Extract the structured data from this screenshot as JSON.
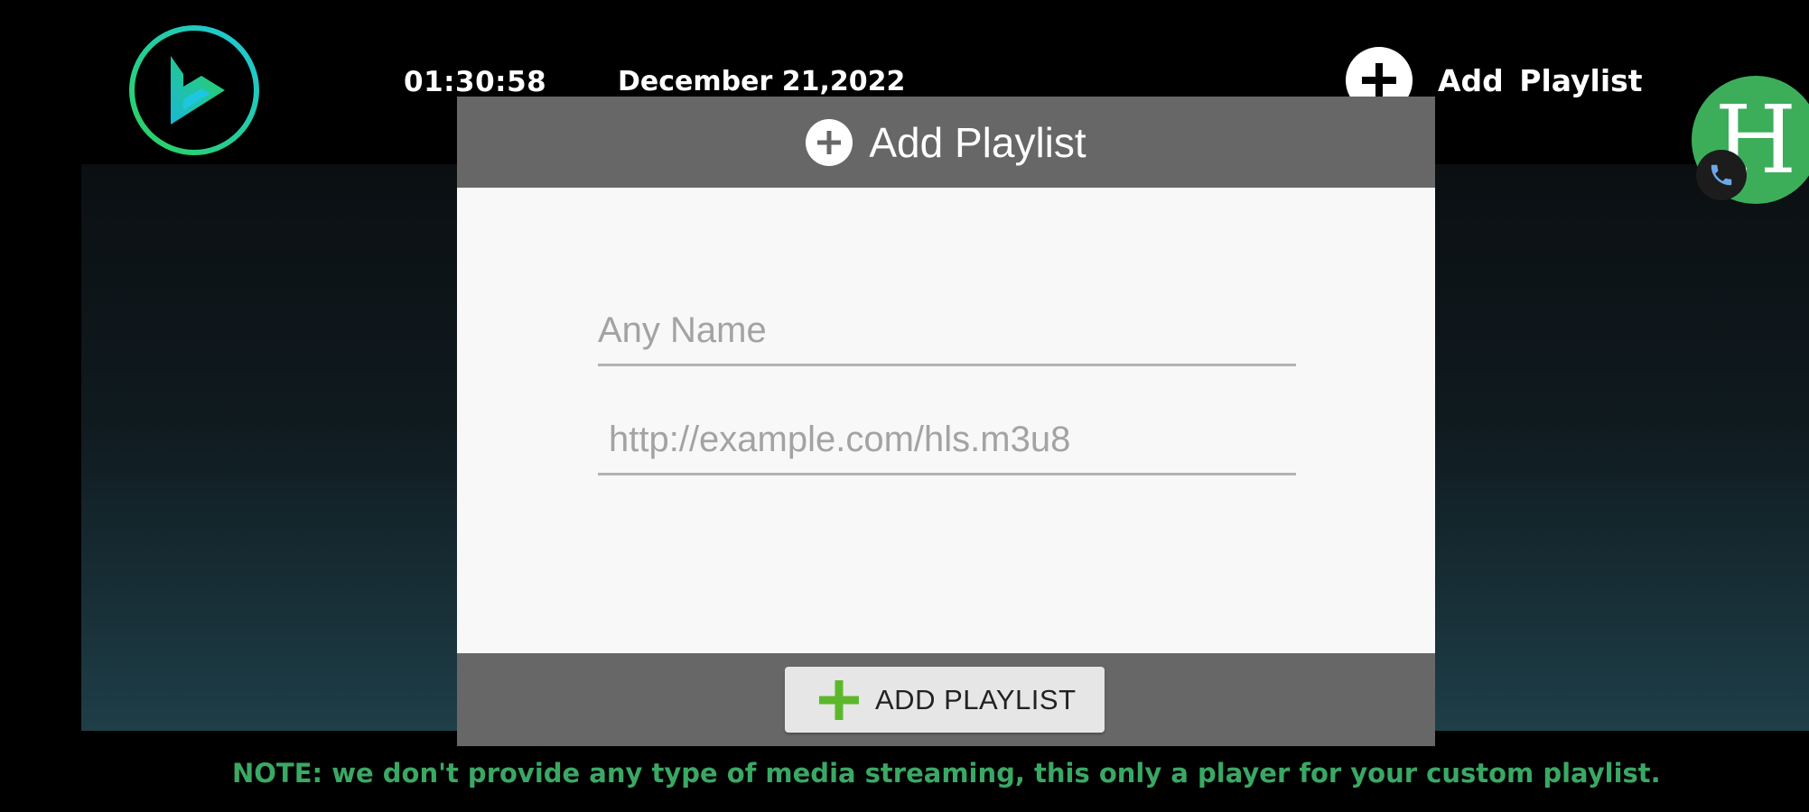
{
  "header": {
    "time": "01:30:58",
    "date": "December 21,2022",
    "add_playlist_label": "Add Playlist",
    "logo_icon": "play-logo-icon",
    "avatar_letter": "H",
    "avatar_badge_icon": "phone-icon"
  },
  "dialog": {
    "title": "Add Playlist",
    "name_field": {
      "value": "",
      "placeholder": "Any Name"
    },
    "url_field": {
      "value": "",
      "placeholder": "http://example.com/hls.m3u8"
    },
    "submit_label": "ADD PLAYLIST"
  },
  "note": "NOTE: we don't provide any type of media streaming, this only a player for your custom playlist.",
  "colors": {
    "background": "#000000",
    "dialog_header": "#676767",
    "dialog_body": "#f8f8f8",
    "accent_green": "#5cb82a",
    "note_green": "#3aa864",
    "avatar_green": "#3cae5a",
    "logo_cyan": "#1ec6e0"
  }
}
